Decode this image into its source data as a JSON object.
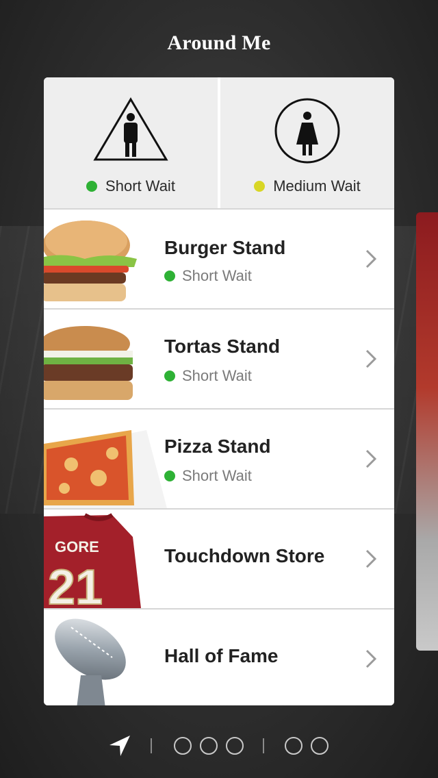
{
  "header": {
    "title": "Around Me"
  },
  "restrooms": [
    {
      "icon": "mens-restroom-icon",
      "wait": "Short Wait",
      "wait_color": "#2eb135"
    },
    {
      "icon": "womens-restroom-icon",
      "wait": "Medium Wait",
      "wait_color": "#d8d625"
    }
  ],
  "items": [
    {
      "name": "Burger Stand",
      "status": "Short Wait",
      "image": "burger-image"
    },
    {
      "name": "Tortas Stand",
      "status": "Short Wait",
      "image": "torta-image"
    },
    {
      "name": "Pizza Stand",
      "status": "Short Wait",
      "image": "pizza-image"
    },
    {
      "name": "Touchdown Store",
      "image": "jersey-image",
      "jersey_name": "GORE",
      "jersey_number": "21"
    },
    {
      "name": "Hall of Fame",
      "image": "trophy-image"
    }
  ],
  "colors": {
    "short_wait": "#2eb135",
    "medium_wait": "#d8d625",
    "accent_red": "#8c1b1f"
  },
  "pagination": {
    "icons": [
      "location-arrow-icon",
      "page-dot",
      "page-dot",
      "page-dot",
      "page-dot",
      "page-dot"
    ]
  }
}
